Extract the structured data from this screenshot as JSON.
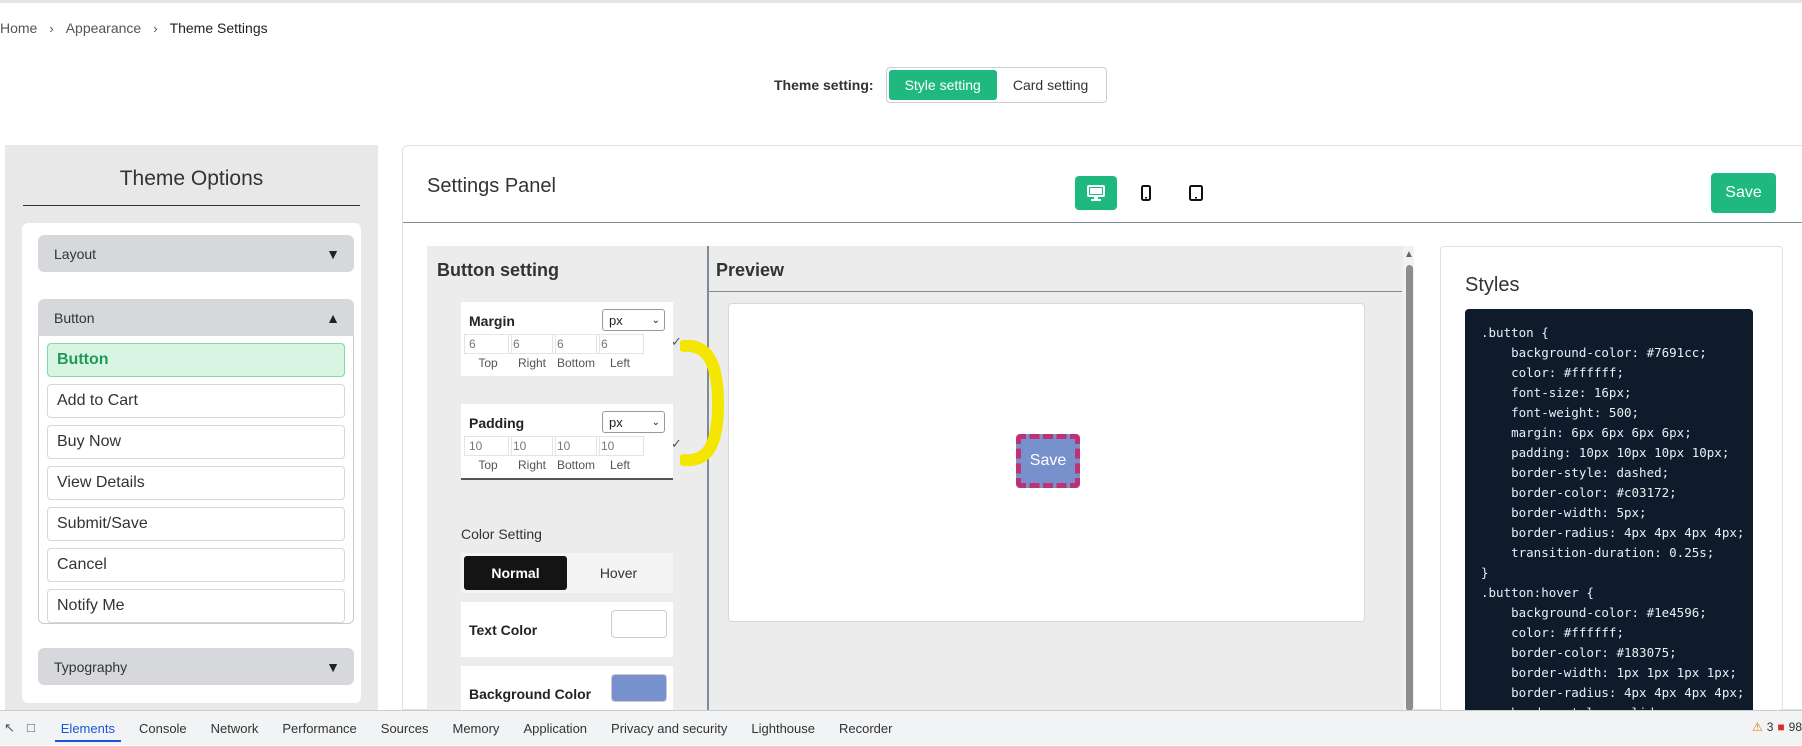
{
  "breadcrumb": {
    "home": "Home",
    "appearance": "Appearance",
    "current": "Theme Settings"
  },
  "theme_setting": {
    "label": "Theme setting:",
    "style": "Style setting",
    "card": "Card setting"
  },
  "theme_options": {
    "title": "Theme Options",
    "sections": {
      "layout": "Layout",
      "button": "Button",
      "typography": "Typography"
    },
    "button_items": [
      "Button",
      "Add to Cart",
      "Buy Now",
      "View Details",
      "Submit/Save",
      "Cancel",
      "Notify Me"
    ],
    "tri_down": "▼",
    "tri_up": "▲"
  },
  "settings_panel": {
    "title": "Settings Panel",
    "save": "Save"
  },
  "button_setting": {
    "title": "Button setting",
    "margin": {
      "label": "Margin",
      "unit": "px",
      "values": [
        "6",
        "6",
        "6",
        "6"
      ]
    },
    "padding": {
      "label": "Padding",
      "unit": "px",
      "values": [
        "10",
        "10",
        "10",
        "10"
      ]
    },
    "sides": [
      "Top",
      "Right",
      "Bottom",
      "Left"
    ],
    "color_setting": "Color Setting",
    "tabs": {
      "normal": "Normal",
      "hover": "Hover"
    },
    "text_color": {
      "label": "Text Color",
      "value": "#ffffff"
    },
    "background_color": {
      "label": "Background Color",
      "value": "#7691cc"
    }
  },
  "preview": {
    "title": "Preview",
    "button_label": "Save",
    "bg": "#7691cc",
    "border": "#c03172"
  },
  "styles": {
    "title": "Styles",
    "code": ".button {\n    background-color: #7691cc;\n    color: #ffffff;\n    font-size: 16px;\n    font-weight: 500;\n    margin: 6px 6px 6px 6px;\n    padding: 10px 10px 10px 10px;\n    border-style: dashed;\n    border-color: #c03172;\n    border-width: 5px;\n    border-radius: 4px 4px 4px 4px;\n    transition-duration: 0.25s;\n}\n.button:hover {\n    background-color: #1e4596;\n    color: #ffffff;\n    border-color: #183075;\n    border-width: 1px 1px 1px 1px;\n    border-radius: 4px 4px 4px 4px;\n    border-style: solid;"
  },
  "devtools": {
    "tabs": [
      "Elements",
      "Console",
      "Network",
      "Performance",
      "Sources",
      "Memory",
      "Application",
      "Privacy and security",
      "Lighthouse",
      "Recorder"
    ],
    "warnings": "3",
    "errors": "98"
  },
  "colors": {
    "accent": "#1fb97f",
    "annotation": "#f3e600",
    "code_bg": "#0f1b2a"
  }
}
